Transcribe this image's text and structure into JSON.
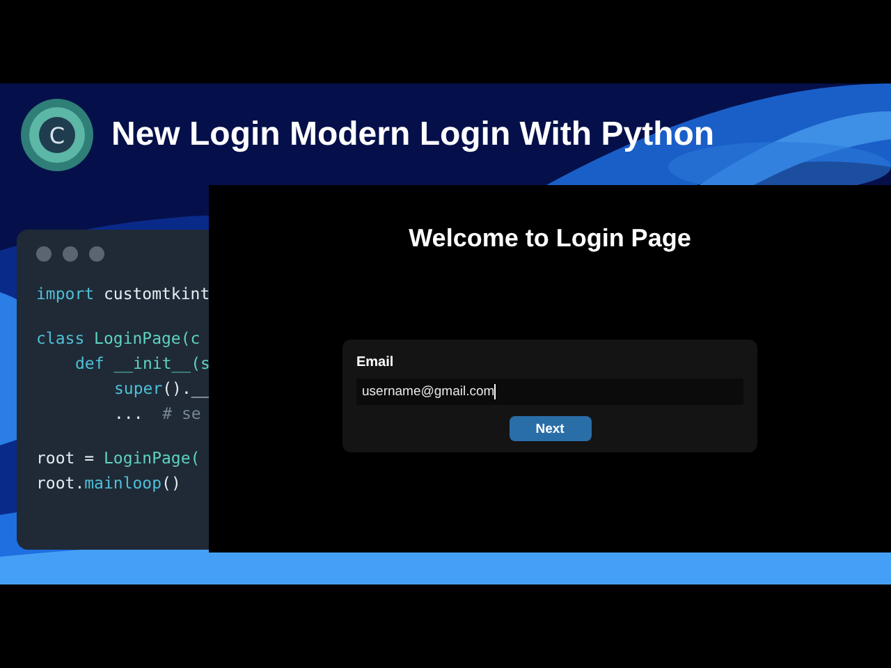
{
  "banner": {
    "logo_letter": "C",
    "title": "New Login Modern Login With Python"
  },
  "code_window": {
    "blocks": [
      [
        {
          "tokens": [
            {
              "text": "import",
              "kind": "keyword"
            },
            {
              "text": " customtkint",
              "kind": "plain"
            }
          ]
        }
      ],
      [
        {
          "tokens": [
            {
              "text": "class",
              "kind": "keyword"
            },
            {
              "text": " LoginPage(c",
              "kind": "name"
            }
          ],
          "children": [
            {
              "tokens": [
                {
                  "text": "def",
                  "kind": "keyword"
                },
                {
                  "text": " __init__(s",
                  "kind": "name"
                }
              ],
              "children": [
                {
                  "tokens": [
                    {
                      "text": "super",
                      "kind": "keyword"
                    },
                    {
                      "text": "().__",
                      "kind": "plain"
                    }
                  ]
                },
                {
                  "tokens": [
                    {
                      "text": "...",
                      "kind": "plain"
                    },
                    {
                      "text": "  # se",
                      "kind": "comment"
                    }
                  ]
                }
              ]
            }
          ]
        }
      ],
      [
        {
          "tokens": [
            {
              "text": "root = ",
              "kind": "plain"
            },
            {
              "text": "LoginPage(",
              "kind": "name"
            }
          ]
        },
        {
          "tokens": [
            {
              "text": "root.",
              "kind": "plain"
            },
            {
              "text": "mainloop",
              "kind": "keyword"
            },
            {
              "text": "()",
              "kind": "plain"
            }
          ]
        }
      ]
    ]
  },
  "app_window": {
    "heading": "Welcome to Login Page",
    "form": {
      "label": "Email",
      "value": "username@gmail.com",
      "focused": true,
      "button": "Next"
    }
  }
}
